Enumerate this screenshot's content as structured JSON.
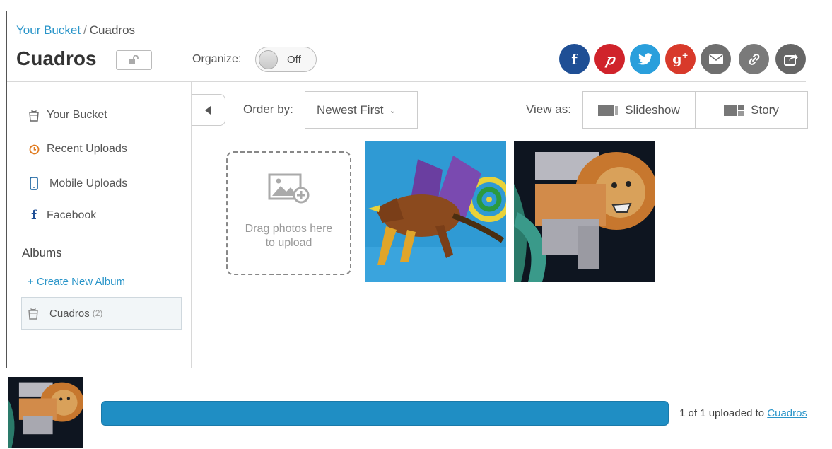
{
  "breadcrumb": {
    "root": "Your Bucket",
    "separator": "/",
    "current": "Cuadros"
  },
  "page_title": "Cuadros",
  "organize": {
    "label": "Organize:",
    "toggle_state": "Off"
  },
  "share_buttons": [
    {
      "name": "facebook",
      "glyph": "f",
      "color": "#1f4f95"
    },
    {
      "name": "pinterest",
      "glyph": "P",
      "color": "#d0232b"
    },
    {
      "name": "twitter",
      "glyph": "t",
      "color": "#2a9fdc"
    },
    {
      "name": "google-plus",
      "glyph": "g+",
      "color": "#d83a2b"
    },
    {
      "name": "email",
      "glyph": "✉",
      "color": "#6f6f6f"
    },
    {
      "name": "link",
      "glyph": "🔗",
      "color": "#7a7a7a"
    },
    {
      "name": "share",
      "glyph": "↗",
      "color": "#666666"
    }
  ],
  "sidebar": {
    "items": [
      {
        "label": "Your Bucket",
        "icon": "bucket-icon"
      },
      {
        "label": "Recent Uploads",
        "icon": "clock-icon"
      },
      {
        "label": "Mobile Uploads",
        "icon": "phone-icon"
      },
      {
        "label": "Facebook",
        "icon": "facebook-icon"
      }
    ],
    "albums_heading": "Albums",
    "create_album": "+ Create New Album",
    "album": {
      "label": "Cuadros",
      "count": "(2)"
    }
  },
  "toolbar": {
    "order_label": "Order by:",
    "order_value": "Newest First",
    "view_label": "View as:",
    "view_options": [
      "Slideshow",
      "Story"
    ]
  },
  "dropzone": {
    "line1": "Drag photos here",
    "line2": "to upload"
  },
  "upload": {
    "progress": 1.0,
    "status_prefix": "1 of 1 uploaded to",
    "status_album": "Cuadros"
  },
  "colors": {
    "link": "#2a95c9",
    "progress": "#1f8ec4"
  }
}
